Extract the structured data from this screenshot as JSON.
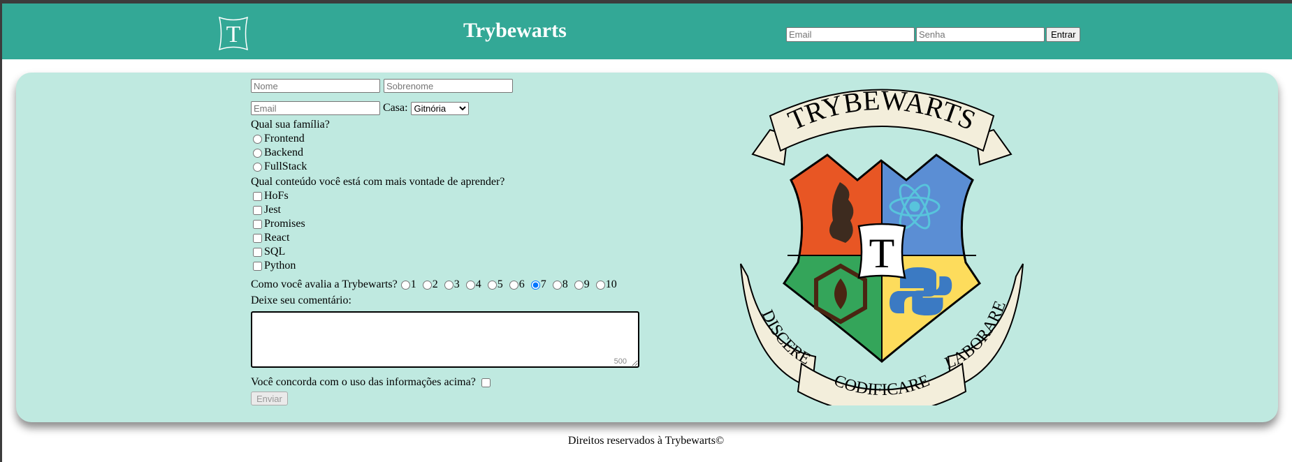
{
  "header": {
    "logo_letter": "T",
    "title": "Trybewarts",
    "login": {
      "email_placeholder": "Email",
      "password_placeholder": "Senha",
      "submit_label": "Entrar"
    }
  },
  "form": {
    "name_placeholder": "Nome",
    "lastname_placeholder": "Sobrenome",
    "email_placeholder": "Email",
    "house_label": "Casa:",
    "house_selected": "Gitnória",
    "family_question": "Qual sua família?",
    "families": [
      "Frontend",
      "Backend",
      "FullStack"
    ],
    "content_question": "Qual conteúdo você está com mais vontade de aprender?",
    "contents": [
      "HoFs",
      "Jest",
      "Promises",
      "React",
      "SQL",
      "Python"
    ],
    "rating_question": "Como você avalia a Trybewarts?",
    "ratings": [
      "1",
      "2",
      "3",
      "4",
      "5",
      "6",
      "7",
      "8",
      "9",
      "10"
    ],
    "rating_selected": "7",
    "comment_label": "Deixe seu comentário:",
    "counter": "500",
    "agreement_label": "Você concorda com o uso das informações acima?",
    "submit_label": "Enviar"
  },
  "crest": {
    "top_banner": "TRYBEWARTS",
    "center_letter": "T",
    "left_banner": "DISCERE",
    "bottom_banner": "CODIFICARE",
    "right_banner": "LABORARE",
    "colors": {
      "orange": "#e85624",
      "blue": "#5b8ed4",
      "green": "#34a55a",
      "yellow": "#fddc5c",
      "parchment": "#f3eedb"
    }
  },
  "footer": {
    "text": "Direitos reservados à Trybewarts©"
  }
}
